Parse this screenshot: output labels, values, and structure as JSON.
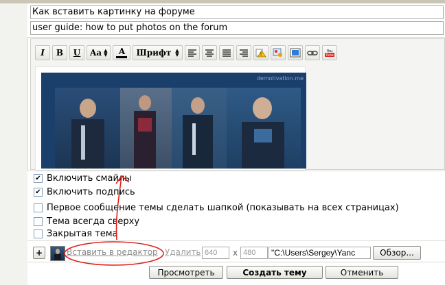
{
  "form": {
    "title_value": "Как вставить картинку на форуме",
    "description_value": "user guide: how to put photos on the forum"
  },
  "toolbar": {
    "italic": "I",
    "bold": "B",
    "underline": "U",
    "fontsize": "Aa",
    "fontcolor": "A",
    "font": "Шрифт",
    "icons": [
      "align-left-icon",
      "align-center-icon",
      "align-justify-icon",
      "align-right-icon",
      "warning-icon",
      "image-paint-icon",
      "image-icon",
      "link-icon",
      "youtube-icon"
    ]
  },
  "editor": {
    "watermark": "demotivation.me"
  },
  "options": {
    "smilies": "Включить смайлы",
    "signature": "Включить подпись",
    "pin_first": "Первое сообщение темы сделать шапкой (показывать на всех страницах)",
    "sticky": "Тема всегда сверху",
    "closed": "Закрытая тема"
  },
  "attach": {
    "plus": "+",
    "insert": "Вставить в редактор",
    "delete": "Удалить",
    "width": "640",
    "x": "x",
    "height": "480",
    "file_path": "\"C:\\Users\\Sergey\\Yanc",
    "browse": "Обзор..."
  },
  "buttons": {
    "preview": "Просмотреть",
    "create": "Создать тему",
    "cancel": "Отменить"
  },
  "youtube_label": "You Tube",
  "colors": {
    "annotation": "#e0201c",
    "link": "#8a8a8a"
  }
}
